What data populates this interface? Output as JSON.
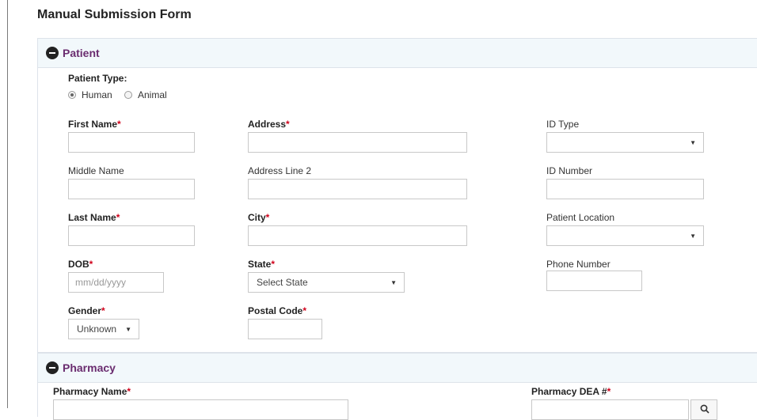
{
  "form": {
    "title": "Manual Submission Form"
  },
  "patient": {
    "section_title": "Patient",
    "patient_type_label": "Patient Type:",
    "patient_type_options": [
      {
        "label": "Human",
        "selected": true
      },
      {
        "label": "Animal",
        "selected": false
      }
    ],
    "first_name_label": "First Name",
    "first_name_value": "",
    "middle_name_label": "Middle Name",
    "middle_name_value": "",
    "last_name_label": "Last Name",
    "last_name_value": "",
    "dob_label": "DOB",
    "dob_placeholder": "mm/dd/yyyy",
    "gender_label": "Gender",
    "gender_value": "Unknown",
    "address_label": "Address",
    "address_value": "",
    "address2_label": "Address Line 2",
    "address2_value": "",
    "city_label": "City",
    "city_value": "",
    "state_label": "State",
    "state_value": "Select State",
    "postal_code_label": "Postal Code",
    "postal_code_value": "",
    "id_type_label": "ID Type",
    "id_type_value": "",
    "id_number_label": "ID Number",
    "id_number_value": "",
    "patient_location_label": "Patient Location",
    "patient_location_value": "",
    "phone_label": "Phone Number",
    "phone_value": ""
  },
  "pharmacy": {
    "section_title": "Pharmacy",
    "name_label": "Pharmacy Name",
    "dea_label": "Pharmacy DEA #"
  },
  "required_marker": "*",
  "dropdown_caret": "▼",
  "colors": {
    "section_title": "#6a2c6f",
    "required": "#d0021b",
    "section_header_bg": "#f2f8fb"
  }
}
